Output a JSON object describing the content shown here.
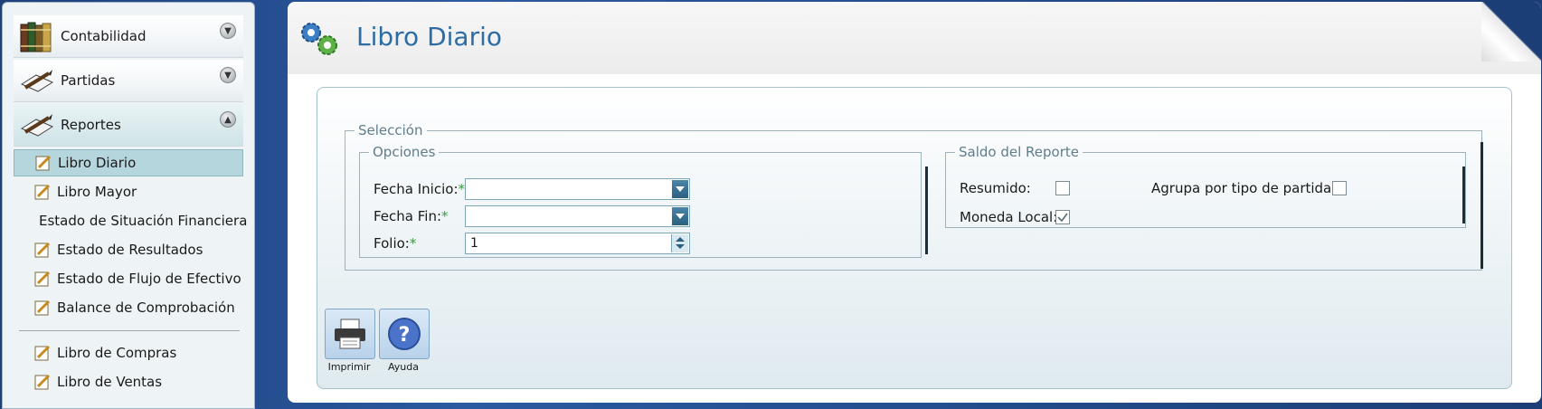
{
  "nav": {
    "headers": [
      {
        "label": "Contabilidad",
        "icon": "books-icon"
      },
      {
        "label": "Partidas",
        "icon": "pencil-paper-icon"
      },
      {
        "label": "Reportes",
        "icon": "pencil-paper-icon"
      }
    ],
    "items": [
      {
        "label": "Libro Diario",
        "selected": true
      },
      {
        "label": "Libro Mayor"
      },
      {
        "label": "Estado de Situación Financiera"
      },
      {
        "label": "Estado de Resultados"
      },
      {
        "label": "Estado de Flujo de Efectivo"
      },
      {
        "label": "Balance de Comprobación"
      },
      {
        "label": "Libro de Compras"
      },
      {
        "label": "Libro de Ventas"
      }
    ]
  },
  "main": {
    "title": "Libro Diario",
    "seleccion": {
      "legend": "Selección",
      "opciones": {
        "legend": "Opciones",
        "fecha_inicio": {
          "label": "Fecha Inicio:",
          "required": "*",
          "value": ""
        },
        "fecha_fin": {
          "label": "Fecha Fin:",
          "required": "*",
          "value": ""
        },
        "folio": {
          "label": "Folio:",
          "required": "*",
          "value": "1"
        }
      },
      "saldo": {
        "legend": "Saldo del Reporte",
        "resumido": {
          "label": "Resumido:",
          "checked": false
        },
        "moneda_local": {
          "label": "Moneda Local:",
          "checked": true
        },
        "agrupa": {
          "label": "Agrupa por tipo de partida?:",
          "checked": false
        }
      }
    },
    "toolbar": {
      "print_label": "Imprimir",
      "help_label": "Ayuda"
    }
  },
  "colors": {
    "title": "#2e6da4",
    "required": "#3e9b3e",
    "selected_nav": "#b6d6dd"
  }
}
